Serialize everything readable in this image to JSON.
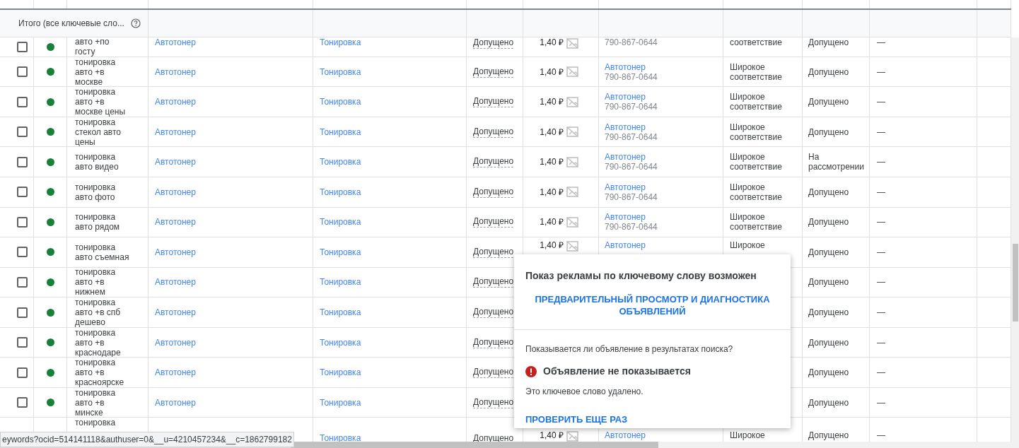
{
  "header": {
    "total_label": "Итого (все ключевые сло..."
  },
  "rows": [
    {
      "checked": false,
      "color": "#188038",
      "keyword": "авто +по госту",
      "ad_group": "Автотонер",
      "campaign": "Тонировка",
      "status": "Допущено",
      "bid": "1,40 ₽",
      "ad_phone": "790-867-0644",
      "match_type": "соответствие",
      "policy": "Допущено",
      "column_11": "—"
    },
    {
      "checked": false,
      "color": "#188038",
      "keyword": "тонировка авто +в москве",
      "ad_group": "Автотонер",
      "campaign": "Тонировка",
      "status": "Допущено",
      "bid": "1,40 ₽",
      "ad_title": "Автотонер",
      "ad_phone": "790-867-0644",
      "match_type": "Широкое соответствие",
      "policy": "Допущено",
      "column_11": "—"
    },
    {
      "checked": false,
      "color": "#188038",
      "keyword": "тонировка авто +в москве цены",
      "ad_group": "Автотонер",
      "campaign": "Тонировка",
      "status": "Допущено",
      "bid": "1,40 ₽",
      "ad_title": "Автотонер",
      "ad_phone": "790-867-0644",
      "match_type": "Широкое соответствие",
      "policy": "Допущено",
      "column_11": "—"
    },
    {
      "checked": false,
      "color": "#188038",
      "keyword": "тонировка стекол авто цены",
      "ad_group": "Автотонер",
      "campaign": "Тонировка",
      "status": "Допущено",
      "bid": "1,40 ₽",
      "ad_title": "Автотонер",
      "ad_phone": "790-867-0644",
      "match_type": "Широкое соответствие",
      "policy": "Допущено",
      "column_11": "—"
    },
    {
      "checked": false,
      "color": "#188038",
      "keyword": "тонировка авто видео",
      "ad_group": "Автотонер",
      "campaign": "Тонировка",
      "status": "Допущено",
      "bid": "1,40 ₽",
      "ad_title": "Автотонер",
      "ad_phone": "790-867-0644",
      "match_type": "Широкое соответствие",
      "policy": "На рассмотрении",
      "column_11": "—"
    },
    {
      "checked": false,
      "color": "#188038",
      "keyword": "тонировка авто фото",
      "ad_group": "Автотонер",
      "campaign": "Тонировка",
      "status": "Допущено",
      "bid": "1,40 ₽",
      "ad_title": "Автотонер",
      "ad_phone": "790-867-0644",
      "match_type": "Широкое соответствие",
      "policy": "Допущено",
      "column_11": "—"
    },
    {
      "checked": false,
      "color": "#188038",
      "keyword": "тонировка авто рядом",
      "ad_group": "Автотонер",
      "campaign": "Тонировка",
      "status": "Допущено",
      "bid": "1,40 ₽",
      "ad_title": "Автотонер",
      "ad_phone": "790-867-0644",
      "match_type": "Широкое соответствие",
      "policy": "Допущено",
      "column_11": "—"
    },
    {
      "checked": false,
      "color": "#188038",
      "keyword": "тонировка авто съемная",
      "ad_group": "Автотонер",
      "campaign": "Тонировка",
      "status": "Допущено",
      "bid": "1,40 ₽",
      "ad_title": "Автотонер",
      "match_type": "Широкое",
      "policy": "Допущено",
      "column_11": "—"
    },
    {
      "checked": false,
      "color": "#188038",
      "keyword": "тонировка авто +в нижнем",
      "ad_group": "Автотонер",
      "campaign": "Тонировка",
      "status": "Допущено",
      "policy": "Допущено",
      "column_11": "—"
    },
    {
      "checked": false,
      "color": "#188038",
      "keyword": "тонировка авто +в спб дешево",
      "ad_group": "Автотонер",
      "campaign": "Тонировка",
      "status": "Допущено",
      "policy": "Допущено",
      "column_11": "—"
    },
    {
      "checked": false,
      "color": "#188038",
      "keyword": "тонировка авто +в краснодаре",
      "ad_group": "Автотонер",
      "campaign": "Тонировка",
      "status": "Допущено",
      "policy": "Допущено",
      "column_11": "—"
    },
    {
      "checked": false,
      "color": "#188038",
      "keyword": "тонировка авто +в красноярске",
      "ad_group": "Автотонер",
      "campaign": "Тонировка",
      "status": "Допущено",
      "policy": "Допущено",
      "column_11": "—"
    },
    {
      "checked": false,
      "color": "#188038",
      "keyword": "тонировка авто +в минске",
      "ad_group": "Автотонер",
      "campaign": "Тонировка",
      "status": "Допущено",
      "policy": "Допущено",
      "column_11": "—"
    },
    {
      "keyword": "тонировка",
      "campaign": "Тонировка",
      "status": "Допущено",
      "bid": "1,40 ₽",
      "ad_title": "Автотонер",
      "match_type": "Широкое",
      "policy": "Допущено",
      "column_11": "—"
    }
  ],
  "popup": {
    "title": "Показ рекламы по ключевому слову возможен",
    "preview_link": "ПРЕДВАРИТЕЛЬНЫЙ ПРОСМОТР И ДИАГНОСТИКА ОБЪЯВЛЕНИЙ",
    "question": "Показывается ли объявление в результатах поиска?",
    "result": "Объявление не показывается",
    "reason": "Это ключевое слово удалено.",
    "recheck_link": "ПРОВЕРИТЬ ЕЩЕ РАЗ"
  },
  "status_url": "eywords?ocid=514141118&authuser=0&__u=4210457234&__c=1862799182"
}
